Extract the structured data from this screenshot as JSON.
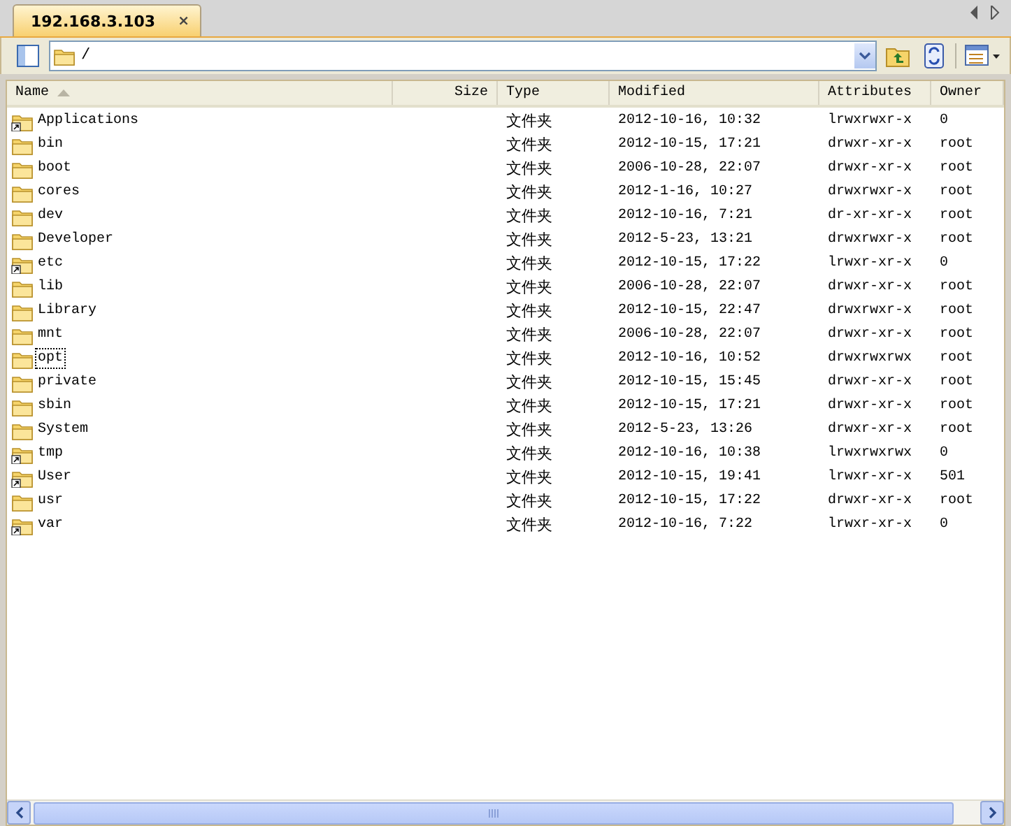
{
  "tabs": [
    {
      "label": "192.168.3.103",
      "close": "×",
      "selected": true
    }
  ],
  "address": {
    "value": "/"
  },
  "columns": [
    {
      "label": "Name",
      "sorted": true
    },
    {
      "label": "Size",
      "sorted": false
    },
    {
      "label": "Type",
      "sorted": false
    },
    {
      "label": "Modified",
      "sorted": false
    },
    {
      "label": "Attributes",
      "sorted": false
    },
    {
      "label": "Owner",
      "sorted": false
    }
  ],
  "rows": [
    {
      "name": "Applications",
      "kind": "link",
      "type": "文件夹",
      "modified": "2012-10-16, 10:32",
      "attributes": "lrwxrwxr-x",
      "owner": "0",
      "focused": false
    },
    {
      "name": "bin",
      "kind": "folder",
      "type": "文件夹",
      "modified": "2012-10-15, 17:21",
      "attributes": "drwxr-xr-x",
      "owner": "root",
      "focused": false
    },
    {
      "name": "boot",
      "kind": "folder",
      "type": "文件夹",
      "modified": "2006-10-28, 22:07",
      "attributes": "drwxr-xr-x",
      "owner": "root",
      "focused": false
    },
    {
      "name": "cores",
      "kind": "folder",
      "type": "文件夹",
      "modified": "2012-1-16, 10:27",
      "attributes": "drwxrwxr-x",
      "owner": "root",
      "focused": false
    },
    {
      "name": "dev",
      "kind": "folder",
      "type": "文件夹",
      "modified": "2012-10-16, 7:21",
      "attributes": "dr-xr-xr-x",
      "owner": "root",
      "focused": false
    },
    {
      "name": "Developer",
      "kind": "folder",
      "type": "文件夹",
      "modified": "2012-5-23, 13:21",
      "attributes": "drwxrwxr-x",
      "owner": "root",
      "focused": false
    },
    {
      "name": "etc",
      "kind": "link",
      "type": "文件夹",
      "modified": "2012-10-15, 17:22",
      "attributes": "lrwxr-xr-x",
      "owner": "0",
      "focused": false
    },
    {
      "name": "lib",
      "kind": "folder",
      "type": "文件夹",
      "modified": "2006-10-28, 22:07",
      "attributes": "drwxr-xr-x",
      "owner": "root",
      "focused": false
    },
    {
      "name": "Library",
      "kind": "folder",
      "type": "文件夹",
      "modified": "2012-10-15, 22:47",
      "attributes": "drwxrwxr-x",
      "owner": "root",
      "focused": false
    },
    {
      "name": "mnt",
      "kind": "folder",
      "type": "文件夹",
      "modified": "2006-10-28, 22:07",
      "attributes": "drwxr-xr-x",
      "owner": "root",
      "focused": false
    },
    {
      "name": "opt",
      "kind": "folder",
      "type": "文件夹",
      "modified": "2012-10-16, 10:52",
      "attributes": "drwxrwxrwx",
      "owner": "root",
      "focused": true
    },
    {
      "name": "private",
      "kind": "folder",
      "type": "文件夹",
      "modified": "2012-10-15, 15:45",
      "attributes": "drwxr-xr-x",
      "owner": "root",
      "focused": false
    },
    {
      "name": "sbin",
      "kind": "folder",
      "type": "文件夹",
      "modified": "2012-10-15, 17:21",
      "attributes": "drwxr-xr-x",
      "owner": "root",
      "focused": false
    },
    {
      "name": "System",
      "kind": "folder",
      "type": "文件夹",
      "modified": "2012-5-23, 13:26",
      "attributes": "drwxr-xr-x",
      "owner": "root",
      "focused": false
    },
    {
      "name": "tmp",
      "kind": "link",
      "type": "文件夹",
      "modified": "2012-10-16, 10:38",
      "attributes": "lrwxrwxrwx",
      "owner": "0",
      "focused": false
    },
    {
      "name": "User",
      "kind": "link",
      "type": "文件夹",
      "modified": "2012-10-15, 19:41",
      "attributes": "lrwxr-xr-x",
      "owner": "501",
      "focused": false
    },
    {
      "name": "usr",
      "kind": "folder",
      "type": "文件夹",
      "modified": "2012-10-15, 17:22",
      "attributes": "drwxr-xr-x",
      "owner": "root",
      "focused": false
    },
    {
      "name": "var",
      "kind": "link",
      "type": "文件夹",
      "modified": "2012-10-16, 7:22",
      "attributes": "lrwxr-xr-x",
      "owner": "0",
      "focused": false
    }
  ]
}
